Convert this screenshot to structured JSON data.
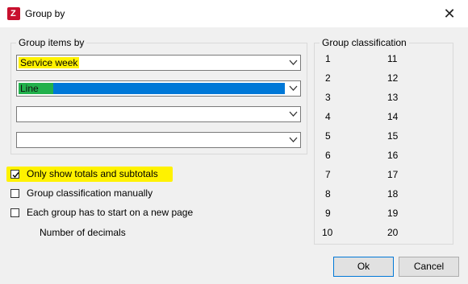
{
  "window": {
    "title": "Group by",
    "close_glyph": "✕"
  },
  "group_items": {
    "legend": "Group items by",
    "combos": [
      {
        "value": "Service week",
        "highlighted": true
      },
      {
        "value": "Line",
        "selected": true
      },
      {
        "value": ""
      },
      {
        "value": ""
      }
    ]
  },
  "options": [
    {
      "label": "Only show totals and subtotals",
      "checked": true,
      "highlighted": true
    },
    {
      "label": "Group classification manually",
      "checked": false
    },
    {
      "label": "Each group has to start on a new page",
      "checked": false
    }
  ],
  "decimals_label": "Number of decimals",
  "classification": {
    "legend": "Group classification",
    "left": [
      "1",
      "2",
      "3",
      "4",
      "5",
      "6",
      "7",
      "8",
      "9",
      "10"
    ],
    "right": [
      "11",
      "12",
      "13",
      "14",
      "15",
      "16",
      "17",
      "18",
      "19",
      "20"
    ]
  },
  "buttons": {
    "ok": "Ok",
    "cancel": "Cancel"
  },
  "colors": {
    "highlight": "#fff200",
    "selection": "#0078d7",
    "green_mark": "#22b14c",
    "app_icon": "#c8102e"
  },
  "icons": {
    "app": "app-logo-icon",
    "close": "close-icon",
    "dropdown": "chevron-down-icon",
    "check": "checkmark-icon"
  }
}
